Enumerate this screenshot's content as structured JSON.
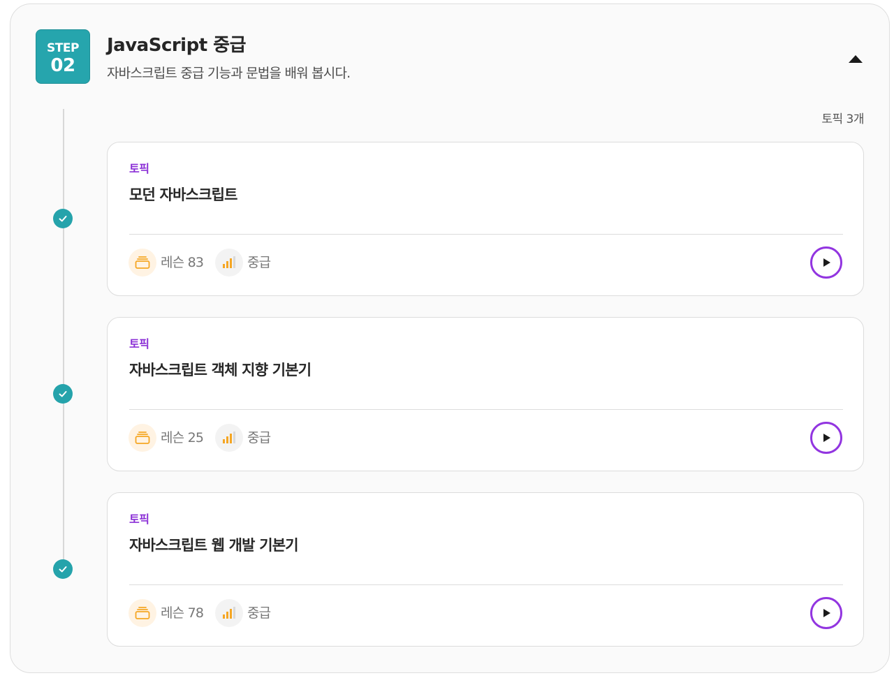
{
  "step": {
    "label": "STEP",
    "number": "02",
    "title": "JavaScript 중급",
    "description": "자바스크립트 중급 기능과 문법을 배워 봅시다.",
    "collapse_icon": "caret-up-icon"
  },
  "topic_count": "토픽 3개",
  "colors": {
    "accent_teal": "#26a5ad",
    "accent_purple": "#9235e0",
    "lesson_orange": "#f5a623"
  },
  "cards": [
    {
      "kind": "토픽",
      "title": "모던 자바스크립트",
      "lessons": "레슨 83",
      "level": "중급",
      "completed": true
    },
    {
      "kind": "토픽",
      "title": "자바스크립트 객체 지향 기본기",
      "lessons": "레슨 25",
      "level": "중급",
      "completed": true
    },
    {
      "kind": "토픽",
      "title": "자바스크립트 웹 개발 기본기",
      "lessons": "레슨 78",
      "level": "중급",
      "completed": true
    }
  ]
}
